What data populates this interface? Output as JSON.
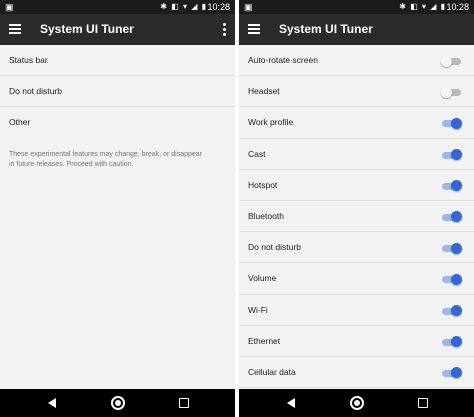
{
  "left_screen": {
    "status_bar": {
      "notification": "▣",
      "icons": "✱ ◧ ▾ ◢ ▮",
      "time": "10:28"
    },
    "app_bar": {
      "title": "System UI Tuner"
    },
    "items": [
      {
        "label": "Status bar"
      },
      {
        "label": "Do not disturb"
      },
      {
        "label": "Other"
      }
    ],
    "note": "These experimental features may change, break, or disappear in future releases. Proceed with caution."
  },
  "right_screen": {
    "status_bar": {
      "notification": "▣",
      "icons": "✱ ◧ ▾ ◢ ▮",
      "time": "10:28"
    },
    "app_bar": {
      "title": "System UI Tuner"
    },
    "items": [
      {
        "label": "Auto-rotate screen",
        "enabled": false
      },
      {
        "label": "Headset",
        "enabled": false
      },
      {
        "label": "Work profile",
        "enabled": true
      },
      {
        "label": "Cast",
        "enabled": true
      },
      {
        "label": "Hotspot",
        "enabled": true
      },
      {
        "label": "Bluetooth",
        "enabled": true
      },
      {
        "label": "Do not disturb",
        "enabled": true
      },
      {
        "label": "Volume",
        "enabled": true
      },
      {
        "label": "Wi-Fi",
        "enabled": true
      },
      {
        "label": "Ethernet",
        "enabled": true
      },
      {
        "label": "Cellular data",
        "enabled": true
      }
    ]
  },
  "colors": {
    "app_bar": "#2b2b2b",
    "status_bar": "#1c1c1c",
    "background": "#f2f2f2",
    "toggle_on_thumb": "#3367d6",
    "toggle_on_track": "#9bb8ec",
    "toggle_off_track": "#b9b9b9"
  },
  "icons": {
    "nav": [
      "back-icon",
      "home-icon",
      "recents-icon"
    ],
    "app_bar": [
      "menu-icon",
      "overflow-menu-icon"
    ]
  }
}
